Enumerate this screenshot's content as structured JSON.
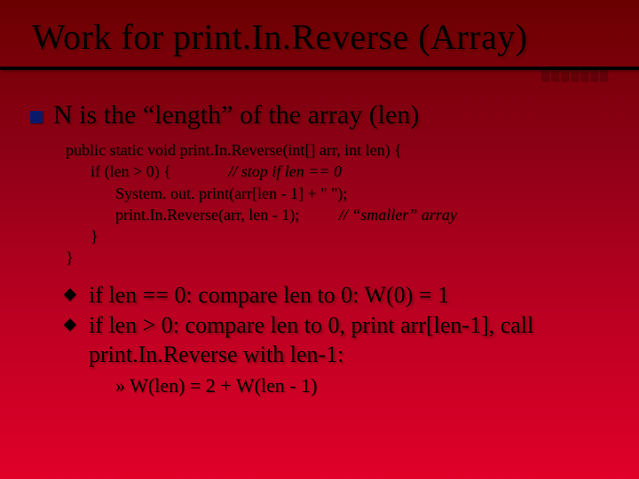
{
  "title": "Work for print.In.Reverse (Array)",
  "bullet1": "N is the “length” of the array (len)",
  "code": {
    "l1": "public static void print.In.Reverse(int[] arr, int len) {",
    "l2a": "if (len > 0) {",
    "l2b": "// stop if len == 0",
    "l3": "System. out. print(arr[len - 1] + \" \");",
    "l4a": "print.In.Reverse(arr, len - 1);",
    "l4b": "// “smaller” array",
    "l5": "}",
    "l6": "}"
  },
  "sub1": "if len == 0: compare len to 0:  W(0) = 1",
  "sub2": "if len > 0: compare len to 0, print arr[len-1], call print.In.Reverse with len-1:",
  "sub3": "» W(len) = 2 + W(len - 1)"
}
